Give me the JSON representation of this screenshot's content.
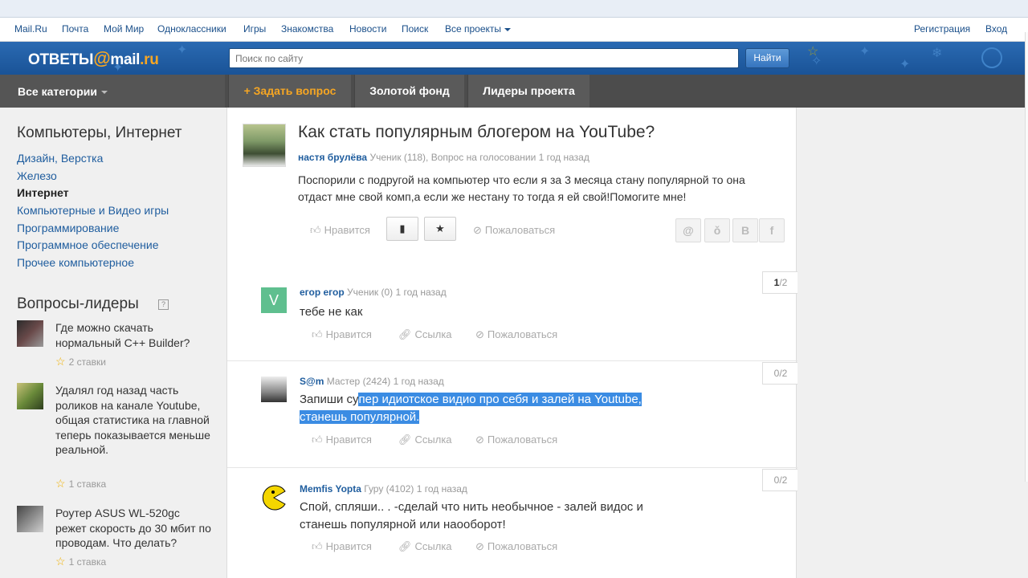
{
  "portal_nav": {
    "items": [
      "Mail.Ru",
      "Почта",
      "Мой Мир",
      "Одноклассники",
      "Игры",
      "Знакомства",
      "Новости",
      "Поиск",
      "Все проекты"
    ],
    "register": "Регистрация",
    "login": "Вход"
  },
  "header": {
    "logo_left": "ОТВЕТЫ",
    "logo_at": "@",
    "logo_mail": "mail",
    "logo_ru": ".ru",
    "search_placeholder": "Поиск по сайту",
    "search_button": "Найти"
  },
  "topnav": {
    "categories": "Все категории",
    "ask": "+ Задать вопрос",
    "gold": "Золотой фонд",
    "leaders": "Лидеры проекта"
  },
  "sidebar": {
    "title": "Компьютеры, Интернет",
    "links": [
      "Дизайн, Верстка",
      "Железо",
      "Интернет",
      "Компьютерные и Видео игры",
      "Программирование",
      "Программное обеспечение",
      "Прочее компьютерное"
    ],
    "active_index": 2,
    "leaders_title": "Вопросы-лидеры",
    "leaders_help": "?",
    "leaders": [
      {
        "question": "Где можно скачать нормальный C++ Builder?",
        "bets": "2 ставки"
      },
      {
        "question": "Удалял год назад часть роликов на канале Youtube, общая статистика на главной теперь показывается меньше реальной.",
        "bets": "1 ставка"
      },
      {
        "question": "Роутер ASUS WL-520gc режет скорость до 30 мбит по проводам. Что делать?",
        "bets": "1 ставка"
      }
    ]
  },
  "question": {
    "title": "Как стать популярным блогером на YouTube?",
    "author": "настя брулёва",
    "meta": "Ученик (118), Вопрос на голосовании 1 год назад",
    "text": "Поспорили с подругой на компьютер что если я за 3 месяца стану популярной то она отдаст мне свой комп,а если же нестану то тогда я ей свой!Помогите мне!",
    "like": "Нравится",
    "bookmark_icon": "bookmark-icon",
    "star_icon": "star-icon",
    "report": "Пожаловаться",
    "share": [
      "@",
      "ok",
      "B",
      "f"
    ]
  },
  "answers": [
    {
      "author": "егор егор",
      "meta": "Ученик (0) 1 год назад",
      "text_plain": "тебе не как",
      "text_highlight": "",
      "vote_current": "1",
      "vote_total": "/2",
      "avatar_letter": "V"
    },
    {
      "author": "S@m",
      "meta": "Мастер (2424) 1 год назад",
      "text_plain": "Запиши су",
      "text_highlight": "пер идиотское видио про себя и залей на Youtube, станешь популярной.",
      "vote_current": "0",
      "vote_total": "/2",
      "avatar_letter": ""
    },
    {
      "author": "Memfis Yopta",
      "meta": "Гуру (4102) 1 год назад",
      "text_plain": "Спой, спляши.. . -сделай что нить необычное - залей видос и станешь популярной или наооборот!",
      "text_highlight": "",
      "vote_current": "0",
      "vote_total": "/2",
      "avatar_letter": ""
    }
  ],
  "answer_actions": {
    "like": "Нравится",
    "link": "Ссылка",
    "report": "Пожаловаться"
  },
  "colors": {
    "header_blue": "#1a5397",
    "link_blue": "#1f5d9e",
    "accent_orange": "#f6a623",
    "selection_blue": "#3b8ce3"
  }
}
